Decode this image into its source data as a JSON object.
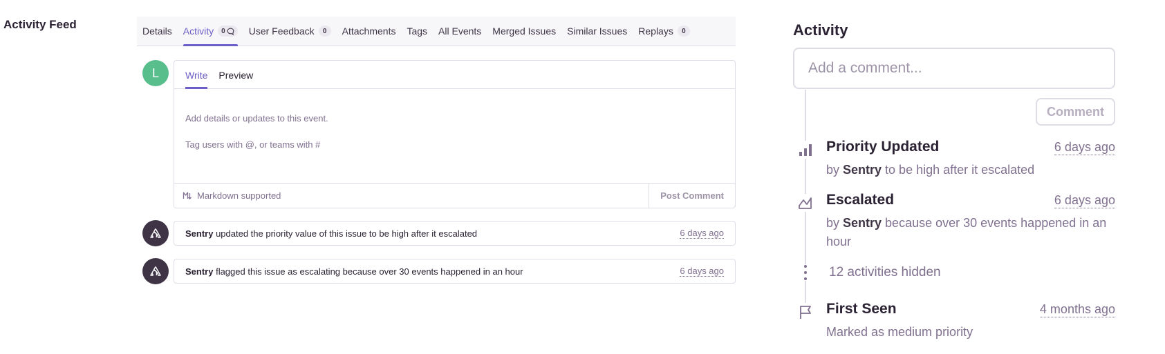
{
  "section_label": "Activity Feed",
  "tabs": [
    {
      "label": "Details",
      "badge": null
    },
    {
      "label": "Activity",
      "badge": "0",
      "active": true
    },
    {
      "label": "User Feedback",
      "badge": "0"
    },
    {
      "label": "Attachments",
      "badge": null
    },
    {
      "label": "Tags",
      "badge": null
    },
    {
      "label": "All Events",
      "badge": null
    },
    {
      "label": "Merged Issues",
      "badge": null
    },
    {
      "label": "Similar Issues",
      "badge": null
    },
    {
      "label": "Replays",
      "badge": "0"
    }
  ],
  "editor": {
    "avatar_letter": "L",
    "tab_write": "Write",
    "tab_preview": "Preview",
    "placeholder_line1": "Add details or updates to this event.",
    "placeholder_line2": "Tag users with @, or teams with #",
    "markdown_note": "Markdown supported",
    "post_button": "Post Comment"
  },
  "feed": [
    {
      "actor": "Sentry",
      "text": " updated the priority value of this issue to be high after it escalated",
      "time": "6 days ago"
    },
    {
      "actor": "Sentry",
      "text": " flagged this issue as escalating because over 30 events happened in an hour",
      "time": "6 days ago"
    }
  ],
  "sidebar": {
    "title": "Activity",
    "comment_placeholder": "Add a comment...",
    "comment_button": "Comment",
    "items": [
      {
        "title": "Priority Updated",
        "time": "6 days ago",
        "by": "by ",
        "actor": "Sentry",
        "rest": " to be high after it escalated"
      },
      {
        "title": "Escalated",
        "time": "6 days ago",
        "by": "by ",
        "actor": "Sentry",
        "rest": " because over 30 events happened in an hour"
      },
      {
        "title": "First Seen",
        "time": "4 months ago",
        "desc": "Marked as medium priority"
      }
    ],
    "hidden_text": "12 activities hidden"
  }
}
